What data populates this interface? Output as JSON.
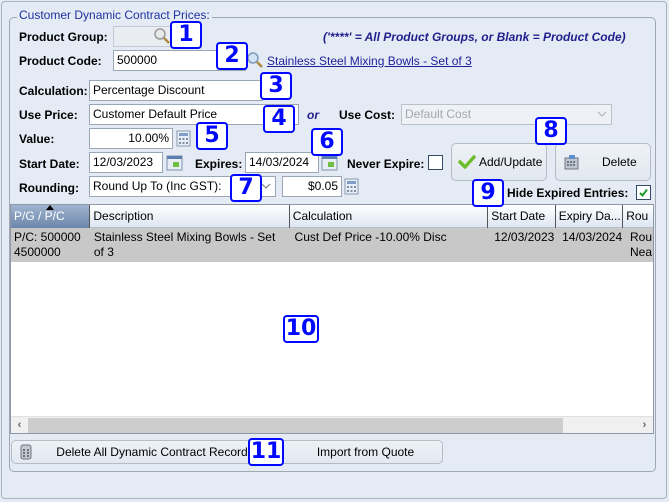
{
  "groupbox": {
    "title": "Customer Dynamic Contract Prices:"
  },
  "form": {
    "product_group_label": "Product Group:",
    "product_group_value": "",
    "product_code_label": "Product Code:",
    "product_code_value": "500000",
    "product_link": "Stainless Steel Mixing Bowls - Set of 3",
    "note": "('****' = All Product Groups, or Blank = Product Code)",
    "calculation_label": "Calculation:",
    "calculation_value": "Percentage Discount",
    "use_price_label": "Use Price:",
    "use_price_value": "Customer Default Price",
    "or_label": "or",
    "use_cost_label": "Use Cost:",
    "use_cost_value": "Default Cost",
    "value_label": "Value:",
    "value_value": "10.00%",
    "start_date_label": "Start Date:",
    "start_date_value": "12/03/2023",
    "expires_label": "Expires:",
    "expires_value": "14/03/2024",
    "never_expire_label": "Never Expire:",
    "never_expire_checked": false,
    "rounding_label": "Rounding:",
    "rounding_value": "Round Up To (Inc GST):",
    "rounding_amount": "$0.05",
    "hide_expired_label": "Hide Expired Entries:",
    "hide_expired_checked": true
  },
  "buttons": {
    "add_update": "Add/Update",
    "delete": "Delete",
    "delete_all": "Delete All Dynamic Contract Records",
    "import_quote": "Import from Quote"
  },
  "table": {
    "columns": [
      "P/G / P/C",
      "Description",
      "Calculation",
      "Start Date",
      "Expiry Da...",
      "Rou"
    ],
    "sorted_column": "P/G / P/C",
    "rows": [
      {
        "pgpc": "P/C: 500000 4500000",
        "description": "Stainless Steel Mixing Bowls - Set of 3",
        "calculation": "Cust Def Price -10.00% Disc",
        "start_date": "12/03/2023",
        "expiry_date": "14/03/2024",
        "rounding": "Rou Nea"
      }
    ]
  },
  "badges": [
    "1",
    "2",
    "3",
    "4",
    "5",
    "6",
    "7",
    "8",
    "9",
    "10",
    "11"
  ],
  "colors": {
    "badge": "#0008ff",
    "title": "#1f33a0",
    "link": "#1f1f9a",
    "row_selected": "#c8c8c8"
  }
}
